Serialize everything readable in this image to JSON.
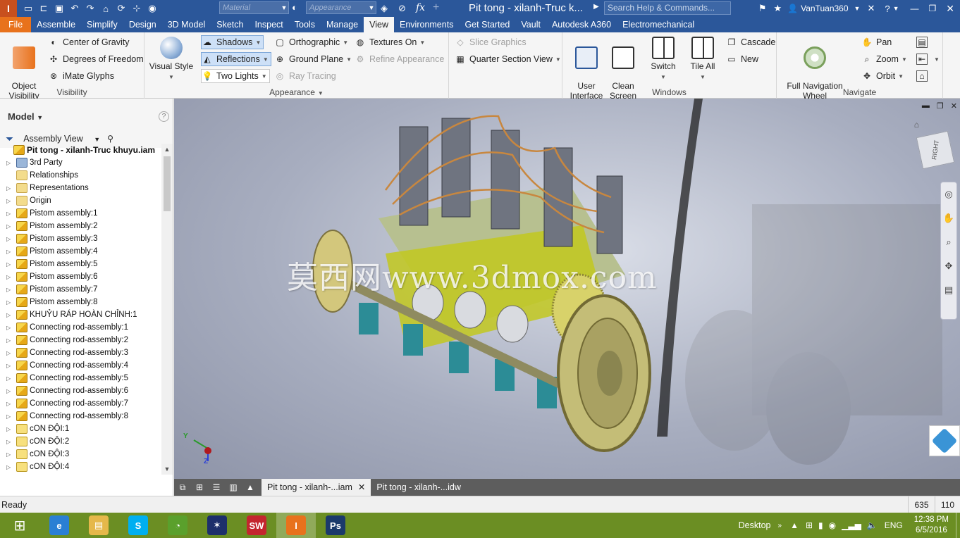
{
  "app": {
    "logo": "I",
    "title": "Pit tong - xilanh-Truc k...",
    "search_placeholder": "Search Help & Commands...",
    "user": "VanTuan360",
    "material_placeholder": "Material",
    "appearance_placeholder": "Appearance",
    "fx_label": "fx"
  },
  "tabs": [
    "File",
    "Assemble",
    "Simplify",
    "Design",
    "3D Model",
    "Sketch",
    "Inspect",
    "Tools",
    "Manage",
    "View",
    "Environments",
    "Get Started",
    "Vault",
    "Autodesk A360",
    "Electromechanical"
  ],
  "active_tab": "View",
  "ribbon": {
    "visibility": {
      "title": "Visibility",
      "object_visibility": "Object\nVisibility",
      "center_of_gravity": "Center of Gravity",
      "degrees_of_freedom": "Degrees of Freedom",
      "imate_glyphs": "iMate Glyphs"
    },
    "appearance": {
      "title": "Appearance",
      "visual_style": "Visual Style",
      "shadows": "Shadows",
      "reflections": "Reflections",
      "two_lights": "Two Lights",
      "orthographic": "Orthographic",
      "ground_plane": "Ground Plane",
      "ray_tracing": "Ray Tracing",
      "textures_on": "Textures On",
      "refine_appearance": "Refine Appearance",
      "slice_graphics": "Slice Graphics",
      "quarter_section_view": "Quarter Section View"
    },
    "windows": {
      "title": "Windows",
      "user_interface": "User\nInterface",
      "clean_screen": "Clean\nScreen",
      "switch": "Switch",
      "tile_all": "Tile All",
      "cascade": "Cascade",
      "new": "New"
    },
    "navigate": {
      "title": "Navigate",
      "full_navigation_wheel": "Full Navigation\nWheel",
      "pan": "Pan",
      "zoom": "Zoom",
      "orbit": "Orbit"
    }
  },
  "browser": {
    "title": "Model",
    "view": "Assembly View",
    "root": "Pit tong - xilanh-Truc khuyu.iam",
    "items": [
      {
        "label": "3rd Party",
        "icon": "3rd"
      },
      {
        "label": "Relationships",
        "icon": "folder",
        "noexp": true
      },
      {
        "label": "Representations",
        "icon": "folder"
      },
      {
        "label": "Origin",
        "icon": "folder"
      },
      {
        "label": "Pistom assembly:1",
        "icon": "asm"
      },
      {
        "label": "Pistom assembly:2",
        "icon": "asm"
      },
      {
        "label": "Pistom assembly:3",
        "icon": "asm"
      },
      {
        "label": "Pistom assembly:4",
        "icon": "asm"
      },
      {
        "label": "Pistom assembly:5",
        "icon": "asm"
      },
      {
        "label": "Pistom assembly:6",
        "icon": "asm"
      },
      {
        "label": "Pistom assembly:7",
        "icon": "asm"
      },
      {
        "label": "Pistom assembly:8",
        "icon": "asm"
      },
      {
        "label": "KHUỶU RÁP HOÀN CHỈNH:1",
        "icon": "asm"
      },
      {
        "label": "Connecting rod-assembly:1",
        "icon": "asm"
      },
      {
        "label": "Connecting rod-assembly:2",
        "icon": "asm"
      },
      {
        "label": "Connecting rod-assembly:3",
        "icon": "asm"
      },
      {
        "label": "Connecting rod-assembly:4",
        "icon": "asm"
      },
      {
        "label": "Connecting rod-assembly:5",
        "icon": "asm"
      },
      {
        "label": "Connecting rod-assembly:6",
        "icon": "asm"
      },
      {
        "label": "Connecting rod-assembly:7",
        "icon": "asm"
      },
      {
        "label": "Connecting rod-assembly:8",
        "icon": "asm"
      },
      {
        "label": "cON ĐỘI:1",
        "icon": "part"
      },
      {
        "label": "cON ĐỘI:2",
        "icon": "part"
      },
      {
        "label": "cON ĐỘI:3",
        "icon": "part"
      },
      {
        "label": "cON ĐỘI:4",
        "icon": "part"
      }
    ]
  },
  "viewport": {
    "watermark": "莫西网www.3dmox.com",
    "viewcube_label": "RIGHT",
    "axis_y": "Y",
    "axis_z": "Z"
  },
  "doc_tabs": [
    {
      "label": "Pit tong - xilanh-...iam",
      "active": true
    },
    {
      "label": "Pit tong - xilanh-...idw",
      "active": false
    }
  ],
  "status": {
    "text": "Ready",
    "x": "635",
    "y": "110"
  },
  "taskbar": {
    "desktop": "Desktop",
    "lang": "ENG",
    "time": "12:38 PM",
    "date": "6/5/2016",
    "apps": [
      {
        "name": "internet-explorer",
        "label": "e",
        "color": "#2a7fd4"
      },
      {
        "name": "file-explorer",
        "label": "▤",
        "color": "#e5b84a"
      },
      {
        "name": "skype",
        "label": "S",
        "color": "#00aff0"
      },
      {
        "name": "app-green",
        "label": "◔",
        "color": "#5aa02c"
      },
      {
        "name": "app-fractal",
        "label": "✶",
        "color": "#1d2f6b"
      },
      {
        "name": "solidworks-2016",
        "label": "SW",
        "color": "#c4262e"
      },
      {
        "name": "inventor-pro",
        "label": "I",
        "color": "#e8721c"
      },
      {
        "name": "photoshop",
        "label": "Ps",
        "color": "#1b3a6b"
      }
    ]
  },
  "colors": {
    "titlebar": "#2b579a",
    "file_tab": "#e8721c",
    "taskbar": "#6b8e23"
  }
}
